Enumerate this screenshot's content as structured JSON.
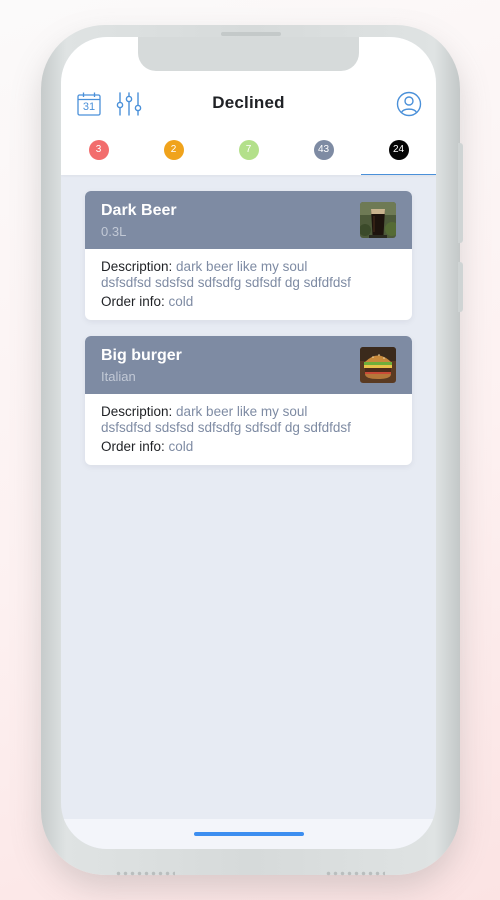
{
  "header": {
    "title": "Declined",
    "calendar_day": "31"
  },
  "tabs": [
    {
      "count": "3",
      "color": "#f26d6d",
      "active": false
    },
    {
      "count": "2",
      "color": "#f0a31c",
      "active": false
    },
    {
      "count": "7",
      "color": "#b3e08a",
      "active": false
    },
    {
      "count": "43",
      "color": "#7e8ba3",
      "active": false
    },
    {
      "count": "24",
      "color": "#050505",
      "active": true
    }
  ],
  "orders": [
    {
      "name": "Dark Beer",
      "subtitle": "0.3L",
      "image": "dark-beer-photo",
      "description_label": "Description:",
      "description_line1": "dark beer like my soul",
      "description_line2": "dsfsdfsd sdsfsd sdfsdfg sdfsdf dg  sdfdfdsf",
      "order_info_label": "Order info:",
      "order_info": "cold"
    },
    {
      "name": "Big burger",
      "subtitle": "Italian",
      "image": "burger-photo",
      "description_label": "Description:",
      "description_line1": "dark beer like my soul",
      "description_line2": "dsfsdfsd sdsfsd sdfsdfg sdfsdf dg  sdfdfdsf",
      "order_info_label": "Order info:",
      "order_info": "cold"
    }
  ],
  "colors": {
    "accent": "#4a90d9",
    "card_header": "#7e8ba3",
    "background": "#e7ebf3",
    "home_indicator": "#3c8ef0"
  }
}
